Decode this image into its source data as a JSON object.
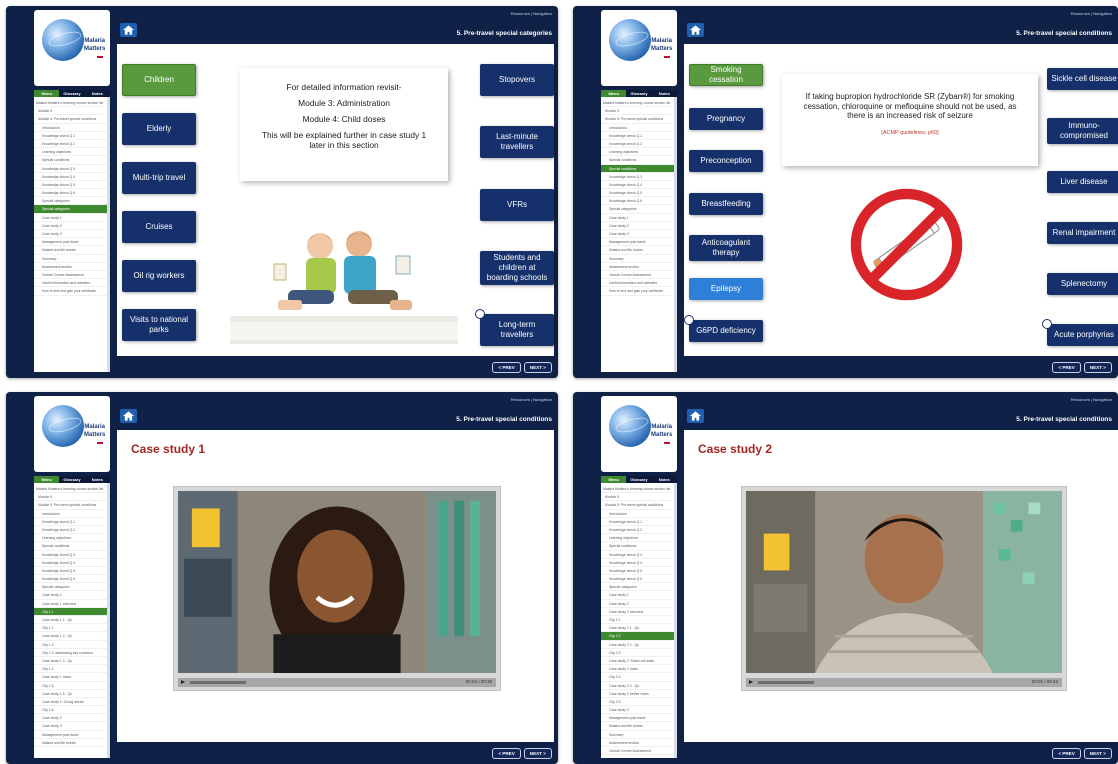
{
  "header": {
    "links": "Resources | Navigation",
    "section": "5. Pre-travel special categories",
    "section_alt": "5. Pre-travel special conditions"
  },
  "logo": {
    "line1": "Malaria",
    "line2": "Matters"
  },
  "sidebar_tabs": [
    "Menu",
    "Glossary",
    "Notes"
  ],
  "nav": {
    "prev": "< PREV",
    "next": "NEXT >"
  },
  "panel1": {
    "sidebar": [
      "Malaria Matters e-learning course section list",
      "Module 5",
      "Module 5: Pre-travel special conditions",
      "Introduction",
      "Knowledge check Q.1",
      "Knowledge check Q.2",
      "Learning objectives",
      "Special conditions",
      "Knowledge check Q.3",
      "Knowledge check Q.4",
      "Knowledge check Q.5",
      "Knowledge check Q.6",
      "Special categories",
      "Special categories",
      "Case study 1",
      "Case study 2",
      "Case study 3",
      "Management post travel",
      "Malaria and life stories",
      "Summary",
      "Assessment section",
      "Overall Course Assessment",
      "Useful information and websites",
      "How to end and gain your certificate"
    ],
    "left_buttons": [
      "Children",
      "Elderly",
      "Multi-trip travel",
      "Cruises",
      "Oil rig workers",
      "Visits to national parks"
    ],
    "right_buttons": [
      "Stopovers",
      "Last-minute travellers",
      "VFRs",
      "Students and children at boarding schools",
      "Long-term travellers"
    ],
    "info": [
      "For detailed information revisit-",
      "Module 3: Administration",
      "Module 4: Child doses",
      "This will be explained further in case study 1 later in this section"
    ]
  },
  "panel2": {
    "sidebar": [
      "Malaria Matters e-learning course section list",
      "Module 5",
      "Module 5: Pre-travel special conditions",
      "Introduction",
      "Knowledge check Q.1",
      "Knowledge check Q.2",
      "Learning objectives",
      "Special conditions",
      "Special conditions",
      "Knowledge check Q.3",
      "Knowledge check Q.4",
      "Knowledge check Q.5",
      "Knowledge check Q.6",
      "Special categories",
      "Case study 1",
      "Case study 2",
      "Case study 3",
      "Management post travel",
      "Malaria and life stories",
      "Summary",
      "Assessment section",
      "Overall Course Assessment",
      "Useful information and websites",
      "How to end and gain your certificate"
    ],
    "left_buttons": [
      "Smoking cessation",
      "Pregnancy",
      "Preconception",
      "Breastfeeding",
      "Anticoagulant therapy",
      "Epilepsy",
      "G6PD deficiency"
    ],
    "right_buttons": [
      "Sickle cell disease",
      "Immuno-compromised",
      "Liver disease",
      "Renal impairment",
      "Splenectomy",
      "Acute porphyrias"
    ],
    "info": "If taking bupropion hydrochloride SR (Zyban®) for smoking cessation, chloroquine or mefloquine should not be used, as there is an increased risk of seizure",
    "ref": "[ACMP guidelines; p60]"
  },
  "panel3": {
    "title": "Case study 1",
    "time": "00:04 / 00:38",
    "sidebar": [
      "Malaria Matters e-learning course section list",
      "Module 5",
      "Module 5: Pre-travel special conditions",
      "Introduction",
      "Knowledge check Q.1",
      "Knowledge check Q.2",
      "Learning objectives",
      "Special conditions",
      "Knowledge check Q.3",
      "Knowledge check Q.4",
      "Knowledge check Q.5",
      "Knowledge check Q.6",
      "Special categories",
      "Case study 1",
      "Case study 1 overview",
      "Clip 1.1",
      "Case study 1.1 - Qs",
      "Clip 1.2",
      "Case study 1.2 - Qs",
      "Clip 1.3",
      "Clip 1.3: addressing key concerns",
      "Case study 1.3 - Qs",
      "Clip 1.4",
      "Case study 1 notes",
      "Clip 1.5",
      "Case study 1.5 - Qs",
      "Case study 1: Giving advice",
      "Clip 1.6",
      "Case study 2",
      "Case study 3",
      "Management post travel",
      "Malaria and life stories"
    ]
  },
  "panel4": {
    "title": "Case study 2",
    "time": "00:01 / 00:42",
    "sidebar": [
      "Malaria Matters e-learning course section list",
      "Module 5",
      "Module 5: Pre-travel special conditions",
      "Introduction",
      "Knowledge check Q.1",
      "Knowledge check Q.2",
      "Learning objectives",
      "Special conditions",
      "Knowledge check Q.3",
      "Knowledge check Q.4",
      "Knowledge check Q.5",
      "Knowledge check Q.6",
      "Special categories",
      "Case study 1",
      "Case study 2",
      "Case study 2 overview",
      "Clip 2.1",
      "Case study 2.1 - Qs",
      "Clip 2.2",
      "Case study 2.2 - Qs",
      "Clip 2.3",
      "Case study 2: Sickle cell traits",
      "Case study 2 notes",
      "Clip 2.4",
      "Case study 2.4 - Qs",
      "Case study 2 further notes",
      "Clip 2.5",
      "Case study 3",
      "Management post travel",
      "Malaria and life stories",
      "Summary",
      "Assessment section",
      "Overall Course Assessment"
    ]
  }
}
